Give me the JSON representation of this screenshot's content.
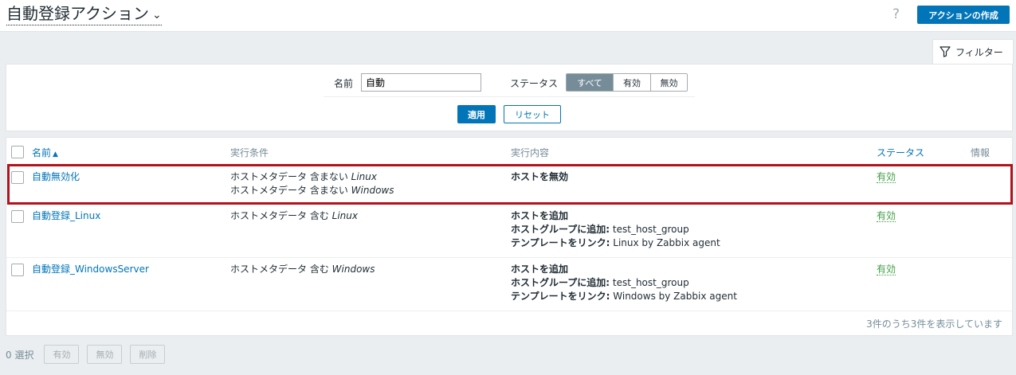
{
  "header": {
    "title": "自動登録アクション",
    "help_icon": "?",
    "create_button": "アクションの作成"
  },
  "filter": {
    "tab_label": "フィルター",
    "name_label": "名前",
    "name_value": "自動",
    "status_label": "ステータス",
    "status_options": [
      "すべて",
      "有効",
      "無効"
    ],
    "status_selected": "すべて",
    "apply_label": "適用",
    "reset_label": "リセット"
  },
  "table": {
    "columns": {
      "name": "名前",
      "conditions": "実行条件",
      "operations": "実行内容",
      "status": "ステータス",
      "info": "情報"
    },
    "rows": [
      {
        "name": "自動無効化",
        "conditions": [
          {
            "text": "ホストメタデータ 含まない ",
            "value": "Linux"
          },
          {
            "text": "ホストメタデータ 含まない ",
            "value": "Windows"
          }
        ],
        "operations": [
          {
            "label": "ホストを無効",
            "value": ""
          }
        ],
        "status": "有効"
      },
      {
        "name": "自動登録_Linux",
        "conditions": [
          {
            "text": "ホストメタデータ 含む ",
            "value": "Linux"
          }
        ],
        "operations": [
          {
            "label": "ホストを追加",
            "value": ""
          },
          {
            "label": "ホストグループに追加:",
            "value": " test_host_group"
          },
          {
            "label": "テンプレートをリンク:",
            "value": " Linux by Zabbix agent"
          }
        ],
        "status": "有効"
      },
      {
        "name": "自動登録_WindowsServer",
        "conditions": [
          {
            "text": "ホストメタデータ 含む ",
            "value": "Windows"
          }
        ],
        "operations": [
          {
            "label": "ホストを追加",
            "value": ""
          },
          {
            "label": "ホストグループに追加:",
            "value": " test_host_group"
          },
          {
            "label": "テンプレートをリンク:",
            "value": " Windows by Zabbix agent"
          }
        ],
        "status": "有効"
      }
    ],
    "footer": "3件のうち3件を表示しています"
  },
  "bottom": {
    "selected": "0 選択",
    "enable": "有効",
    "disable": "無効",
    "delete": "削除"
  },
  "colors": {
    "accent": "#0275b8",
    "status_enabled": "#429e47",
    "highlight": "#b3121d"
  }
}
